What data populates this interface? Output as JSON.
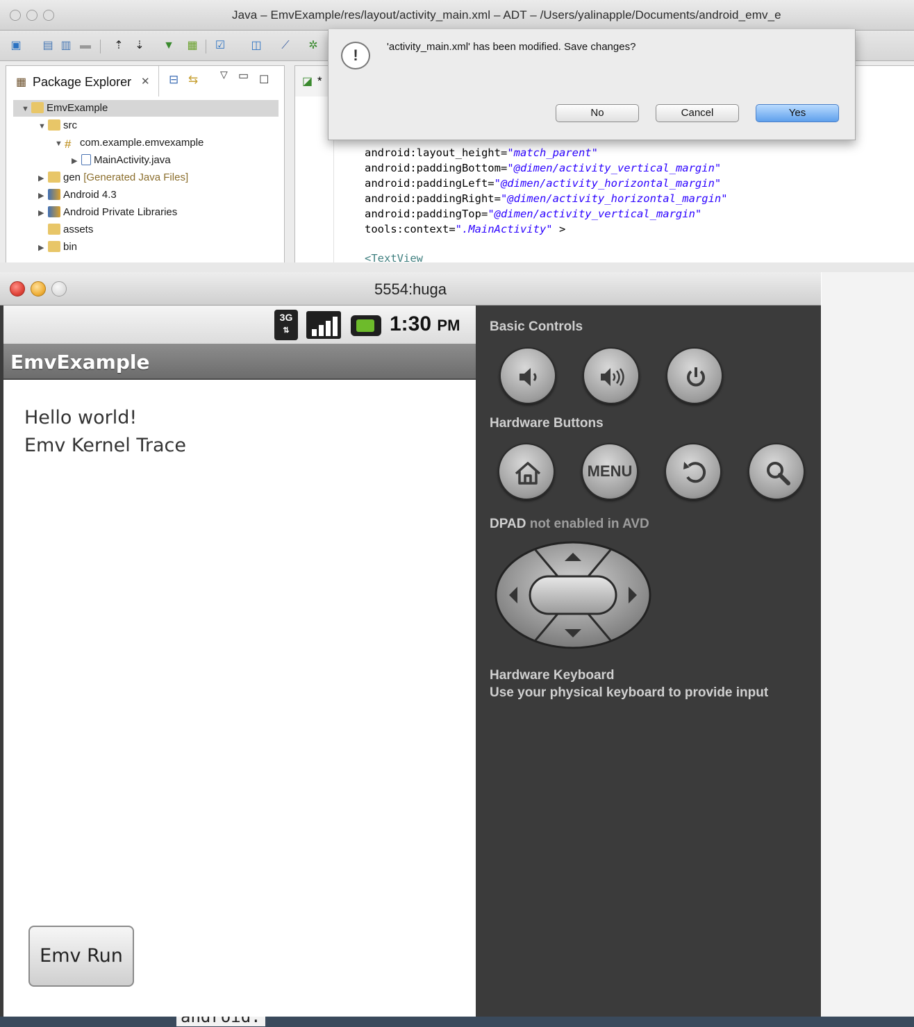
{
  "adt": {
    "title": "Java – EmvExample/res/layout/activity_main.xml – ADT – /Users/yalinapple/Documents/android_emv_e",
    "package_explorer": {
      "tab_label": "Package Explorer",
      "tree": [
        {
          "label": "EmvExample"
        },
        {
          "label": "src"
        },
        {
          "label": "com.example.emvexample"
        },
        {
          "label": "MainActivity.java"
        },
        {
          "label": "gen",
          "extra": "[Generated Java Files]"
        },
        {
          "label": "Android 4.3"
        },
        {
          "label": "Android Private Libraries"
        },
        {
          "label": "assets"
        },
        {
          "label": "bin"
        }
      ]
    },
    "editor": {
      "tab_label": "*",
      "code": [
        {
          "attr": "android:layout_height=",
          "val": "\"match_parent\""
        },
        {
          "attr": "android:paddingBottom=",
          "val": "\"@dimen/activity_vertical_margin\""
        },
        {
          "attr": "android:paddingLeft=",
          "val": "\"@dimen/activity_horizontal_margin\""
        },
        {
          "attr": "android:paddingRight=",
          "val": "\"@dimen/activity_horizontal_margin\""
        },
        {
          "attr": "android:paddingTop=",
          "val": "\"@dimen/activity_vertical_margin\""
        },
        {
          "attr": "tools:context=",
          "val": "\".MainActivity\"",
          "tail": " >"
        },
        {
          "attr": "<TextView",
          "val": ""
        }
      ]
    },
    "dialog": {
      "message": "'activity_main.xml' has been modified. Save changes?",
      "no_label": "No",
      "cancel_label": "Cancel",
      "yes_label": "Yes"
    }
  },
  "emulator": {
    "title": "5554:huga",
    "status": {
      "network": "3G",
      "time": "1:30",
      "ampm": "PM"
    },
    "app_title": "EmvExample",
    "text_lines": [
      "Hello world!",
      "Emv Kernel Trace"
    ],
    "run_button": "Emv Run",
    "controls": {
      "basic_controls_label": "Basic Controls",
      "hardware_buttons_label": "Hardware Buttons",
      "menu_label": "MENU",
      "dpad_label": "DPAD",
      "dpad_note": "not enabled in AVD",
      "keyboard_title": "Hardware Keyboard",
      "keyboard_desc": "Use your physical keyboard to provide input"
    }
  },
  "background": {
    "code_fragment": "android:"
  },
  "colors": {
    "accent_yes": "#5fa0ec",
    "close": "#e0443a",
    "minimize": "#f0b13c",
    "panel": "#3b3b3b",
    "battery": "#6dbb2b"
  }
}
